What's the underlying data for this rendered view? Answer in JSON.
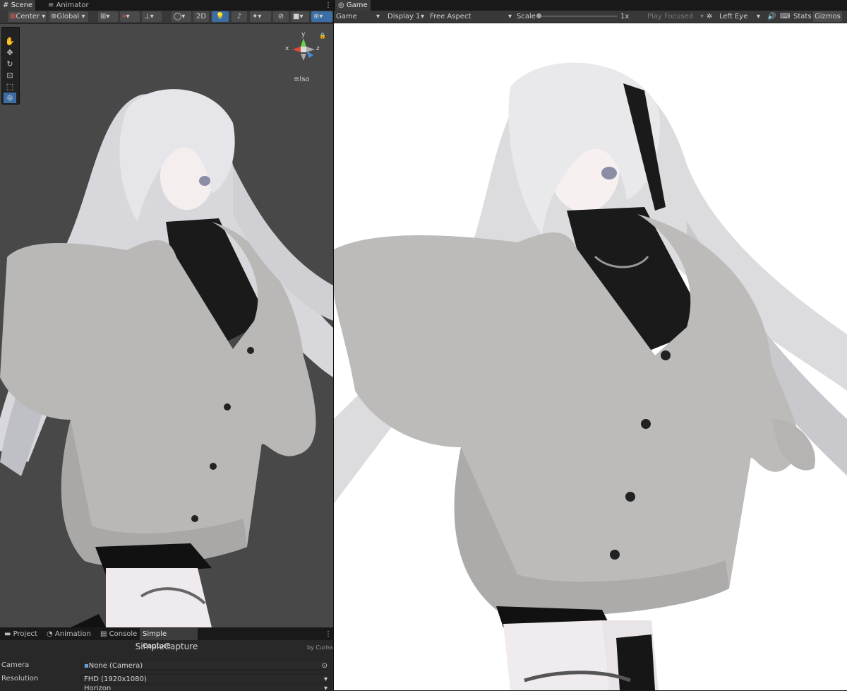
{
  "scene": {
    "tabs": [
      {
        "label": "Scene",
        "icon": "hash-icon"
      },
      {
        "label": "Animator",
        "icon": "animator-icon"
      }
    ],
    "toolbar": {
      "pivot": "Center",
      "space": "Global",
      "mode_2d": "2D"
    },
    "gizmo": {
      "x": "x",
      "y": "y",
      "z": "z",
      "projection": "Iso"
    }
  },
  "bottom": {
    "tabs": [
      "Project",
      "Animation",
      "Console",
      "Simple Capture"
    ],
    "title": "SimpleCapture",
    "byline": "by Curiss",
    "props": [
      {
        "label": "Camera",
        "value": "None (Camera)"
      },
      {
        "label": "Resolution",
        "value": "FHD (1920x1080)"
      },
      {
        "label": "",
        "value": "Horizon"
      }
    ]
  },
  "game": {
    "tab": "Game",
    "toolbar": {
      "view": "Game",
      "display": "Display 1",
      "aspect": "Free Aspect",
      "scale_label": "Scale",
      "scale_value": "1x",
      "play_mode": "Play Focused",
      "eye": "Left Eye",
      "stats": "Stats",
      "gizmos": "Gizmos"
    }
  },
  "colors": {
    "accent": "#3a6ea5",
    "panel": "#282828",
    "viewport": "#484848"
  }
}
